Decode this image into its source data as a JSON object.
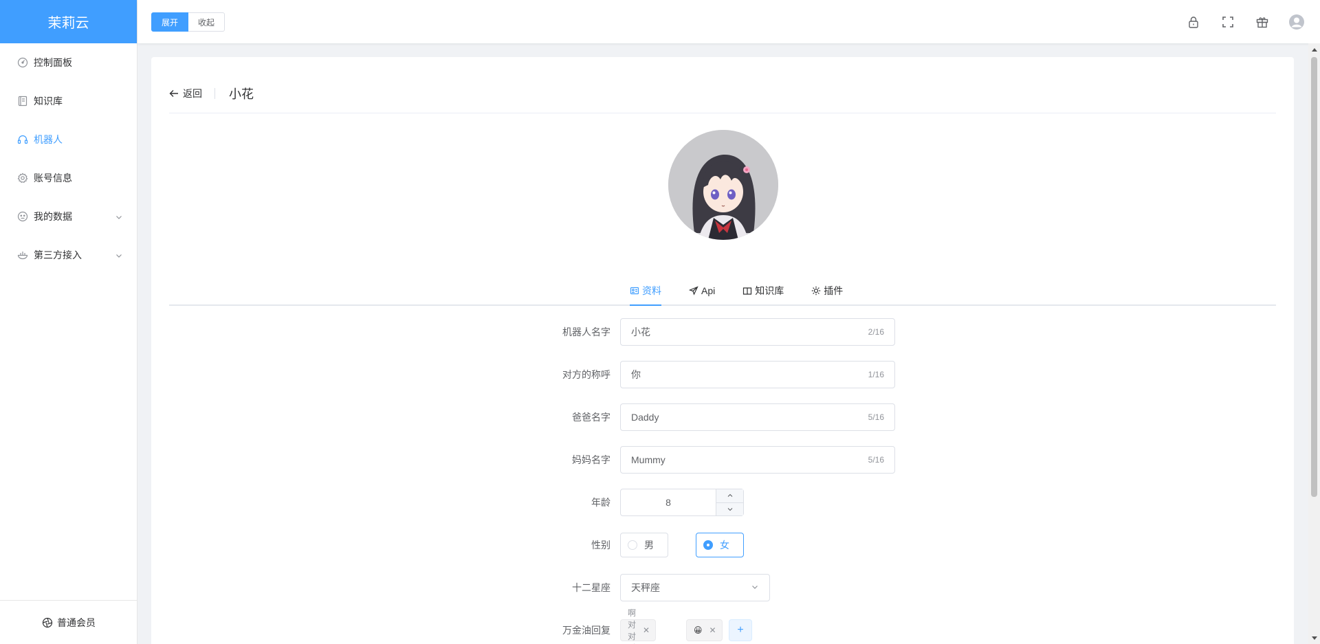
{
  "brand": "茉莉云",
  "sidebar": {
    "items": [
      {
        "label": "控制面板",
        "icon": "dashboard-icon"
      },
      {
        "label": "知识库",
        "icon": "book-icon"
      },
      {
        "label": "机器人",
        "icon": "headset-icon",
        "active": true
      },
      {
        "label": "账号信息",
        "icon": "gear-icon"
      },
      {
        "label": "我的数据",
        "icon": "face-icon",
        "expandable": true
      },
      {
        "label": "第三方接入",
        "icon": "bowl-icon",
        "expandable": true
      }
    ],
    "footer": "普通会员"
  },
  "header": {
    "expand_label": "展开",
    "collapse_label": "收起",
    "icons": [
      "lock-icon",
      "fullscreen-icon",
      "gift-icon",
      "user-icon"
    ]
  },
  "page": {
    "back_label": "返回",
    "title": "小花"
  },
  "tabs": [
    {
      "label": "资料",
      "icon": "profile-icon",
      "active": true
    },
    {
      "label": "Api",
      "icon": "send-icon"
    },
    {
      "label": "知识库",
      "icon": "open-book-icon"
    },
    {
      "label": "插件",
      "icon": "sun-icon"
    }
  ],
  "form": {
    "robot_name": {
      "label": "机器人名字",
      "value": "小花",
      "count": "2/16"
    },
    "call_name": {
      "label": "对方的称呼",
      "value": "你",
      "count": "1/16"
    },
    "dad_name": {
      "label": "爸爸名字",
      "value": "Daddy",
      "count": "5/16"
    },
    "mom_name": {
      "label": "妈妈名字",
      "value": "Mummy",
      "count": "5/16"
    },
    "age": {
      "label": "年龄",
      "value": "8"
    },
    "gender": {
      "label": "性别",
      "male": "男",
      "female": "女",
      "selected": "女"
    },
    "zodiac": {
      "label": "十二星座",
      "value": "天秤座"
    },
    "universal_reply": {
      "label": "万金油回复",
      "tags": [
        "啊对对对",
        "😀"
      ],
      "add": "+"
    }
  },
  "colors": {
    "accent": "#409eff",
    "text": "#303133",
    "muted": "#909399"
  }
}
